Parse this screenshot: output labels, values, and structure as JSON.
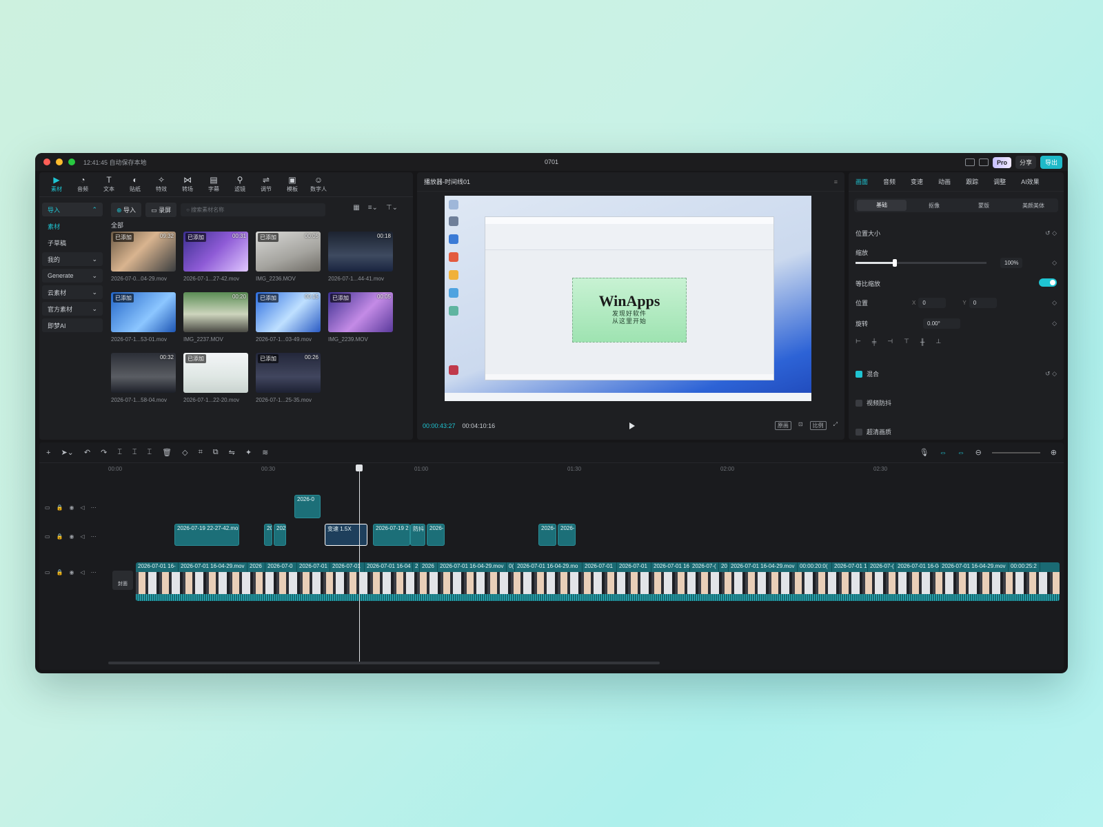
{
  "window": {
    "autosave": "12:41:45 自动保存本地",
    "project_title": "0701",
    "pro_label": "Pro",
    "share_label": "分享",
    "export_label": "导出"
  },
  "toolbar": {
    "tools": [
      {
        "label": "素材",
        "icon": "media-icon"
      },
      {
        "label": "音频",
        "icon": "audio-icon"
      },
      {
        "label": "文本",
        "icon": "text-icon"
      },
      {
        "label": "贴纸",
        "icon": "sticker-icon"
      },
      {
        "label": "特效",
        "icon": "effects-icon"
      },
      {
        "label": "转场",
        "icon": "transition-icon"
      },
      {
        "label": "字幕",
        "icon": "subtitle-icon"
      },
      {
        "label": "滤镜",
        "icon": "filter-icon"
      },
      {
        "label": "调节",
        "icon": "adjust-icon"
      },
      {
        "label": "模板",
        "icon": "template-icon"
      },
      {
        "label": "数字人",
        "icon": "avatar-icon"
      }
    ]
  },
  "sidebar": {
    "items": [
      "导入",
      "素材",
      "子草稿",
      "我的",
      "Generate",
      "云素材",
      "官方素材",
      "即梦AI"
    ]
  },
  "media": {
    "import_label": "导入",
    "record_label": "录屏",
    "search_placeholder": "搜索素材名称",
    "all_label": "全部",
    "cards": [
      {
        "name": "2026-07-0...04-29.mov",
        "added": "已添加",
        "duration": "09:32",
        "thumb": "linear-gradient(135deg,#6b5a45,#d9b48f 45%,#3a3d3f)"
      },
      {
        "name": "2026-07-1...27-42.mov",
        "added": "已添加",
        "duration": "00:31",
        "thumb": "linear-gradient(135deg,#3b2f8f,#8e5bd6 50%,#e0c7ff)"
      },
      {
        "name": "IMG_2236.MOV",
        "added": "已添加",
        "duration": "00:05",
        "thumb": "linear-gradient(160deg,#d8d8d6,#a5a49f 60%,#6f6c66)"
      },
      {
        "name": "2026-07-1...44-41.mov",
        "added": "",
        "duration": "00:18",
        "thumb": "linear-gradient(180deg,#1c2330,#3e4a60 60%,#1a2540)"
      },
      {
        "name": "2026-07-1...53-01.mov",
        "added": "已添加",
        "duration": "",
        "thumb": "linear-gradient(135deg,#2366c9,#8cc6ff 60%,#1d55b3)"
      },
      {
        "name": "IMG_2237.MOV",
        "added": "",
        "duration": "00:20",
        "thumb": "linear-gradient(180deg,#5b8d55,#cdd5bd 55%,#4a4a44)"
      },
      {
        "name": "2026-07-1...03-49.mov",
        "added": "已添加",
        "duration": "00:15",
        "thumb": "linear-gradient(135deg,#2c6de0,#bfe0ff 55%,#2a5bc4)"
      },
      {
        "name": "IMG_2239.MOV",
        "added": "已添加",
        "duration": "00:05",
        "thumb": "linear-gradient(135deg,#3b2f8f,#c48be6 55%,#5a3a9c)"
      },
      {
        "name": "2026-07-1...58-04.mov",
        "added": "",
        "duration": "00:32",
        "thumb": "linear-gradient(180deg,#2b2e36,#5a5d63 60%,#1d2029)"
      },
      {
        "name": "2026-07-1...22-20.mov",
        "added": "已添加",
        "duration": "",
        "thumb": "linear-gradient(180deg,#f3f5f7,#dfe7e4 60%,#c9d3cf)"
      },
      {
        "name": "2026-07-1...25-35.mov",
        "added": "已添加",
        "duration": "00:26",
        "thumb": "linear-gradient(180deg,#23273a,#41465e 60%,#1d2133)"
      }
    ]
  },
  "player": {
    "title": "播放器-时间线01",
    "logo_text": "WinApps",
    "logo_sub1": "发现好软件",
    "logo_sub2": "从这里开始",
    "current_time": "00:00:43:27",
    "total_time": "00:04:10:16",
    "btn_original": "原画",
    "btn_ratio": "比例"
  },
  "inspector": {
    "tabs": [
      "画面",
      "音频",
      "变速",
      "动画",
      "跟踪",
      "调整",
      "AI效果"
    ],
    "subtabs": [
      "基础",
      "抠像",
      "蒙版",
      "美颜美体"
    ],
    "section_pos": "位置大小",
    "scale_label": "缩放",
    "scale_value": "100%",
    "scale_level": 0.3,
    "uniform_label": "等比缩放",
    "position_label": "位置",
    "pos_x_label": "X",
    "pos_x": "0",
    "pos_y_label": "Y",
    "pos_y": "0",
    "rotation_label": "旋转",
    "rotation_value": "0.00°",
    "blend_label": "混合",
    "stabilize_label": "视频防抖",
    "hd_label": "超清画质"
  },
  "timeline": {
    "ruler": [
      "00:00",
      "00:30",
      "01:00",
      "01:30",
      "02:00",
      "02:30"
    ],
    "cover_label": "封面",
    "top_clip": "2026-0",
    "mid_clips": [
      "2026-07-19 22-27-42.mo",
      "20",
      "202",
      "变速 1.5X",
      "2026-07-19 2",
      "防抖",
      "2026-",
      "2026-",
      "2026-"
    ],
    "main_labels": [
      "2026-07-01 16-",
      "2026-07-01 16-04-29.mov",
      "2026",
      "2026-07-0",
      "2026-07-01",
      "2026-07-01",
      "2026-07-01 16-04",
      "2",
      "2026",
      "2026-07-01 16-04-29.mov",
      "0(",
      "2026-07-01 16-04-29.mo",
      "2026-07-01",
      "2026-07-01",
      "2026-07-01 16-0",
      "2026-07-(",
      "20",
      "2026-07-01 16-04-29.mov",
      "00:00:20:0(",
      "2026-07-01 1",
      "2026-07-(",
      "2026-07-01 16-04",
      "2026-07-01 16-04-29.mov",
      "00:00:25:2"
    ]
  }
}
